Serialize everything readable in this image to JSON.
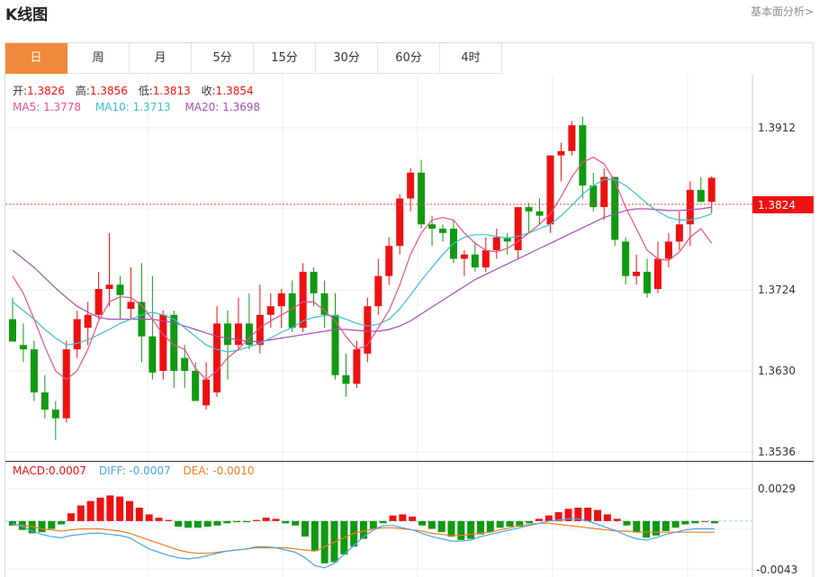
{
  "header": {
    "title": "K线图",
    "link": "基本面分析>"
  },
  "tabs": [
    {
      "label": "日",
      "active": true
    },
    {
      "label": "周"
    },
    {
      "label": "月"
    },
    {
      "label": "5分"
    },
    {
      "label": "15分"
    },
    {
      "label": "30分"
    },
    {
      "label": "60分"
    },
    {
      "label": "4时"
    }
  ],
  "legend": {
    "open_label": "开:",
    "open": "1.3826",
    "high_label": "高:",
    "high": "1.3856",
    "low_label": "低:",
    "low": "1.3813",
    "close_label": "收:",
    "close": "1.3854",
    "ma5_label": "MA5:",
    "ma5": "1.3778",
    "ma10_label": "MA10:",
    "ma10": "1.3713",
    "ma20_label": "MA20:",
    "ma20": "1.3698",
    "macd_label": "MACD:",
    "macd": "0.0007",
    "diff_label": "DIFF:",
    "diff": "-0.0007",
    "dea_label": "DEA:",
    "dea": "-0.0010"
  },
  "colors": {
    "up": "#ee1111",
    "down": "#119911",
    "ma5": "#e8508a",
    "ma10": "#3bbfd0",
    "ma20": "#a64eb5",
    "diff": "#48a5e6",
    "dea": "#f07c1e",
    "current": "#ff2a2a"
  },
  "chart_data": {
    "type": "candlestick",
    "price_axis": {
      "ticks": [
        "1.3912",
        "1.3724",
        "1.3630",
        "1.3536"
      ],
      "min": 1.3536,
      "max": 1.3912
    },
    "current_price": "1.3824",
    "macd_axis": {
      "ticks": [
        "0.0029",
        "-0.0043"
      ],
      "min": -0.0043,
      "max": 0.0029
    },
    "candles": [
      [
        1.369,
        1.3715,
        1.3665,
        1.3664
      ],
      [
        1.366,
        1.3685,
        1.364,
        1.3655
      ],
      [
        1.3655,
        1.3665,
        1.3595,
        1.3605
      ],
      [
        1.3605,
        1.3625,
        1.3575,
        1.3585
      ],
      [
        1.3585,
        1.3595,
        1.355,
        1.3575
      ],
      [
        1.3575,
        1.3665,
        1.357,
        1.3655
      ],
      [
        1.3655,
        1.37,
        1.3645,
        1.369
      ],
      [
        1.368,
        1.371,
        1.366,
        1.3695
      ],
      [
        1.3695,
        1.3745,
        1.369,
        1.3725
      ],
      [
        1.3725,
        1.379,
        1.3705,
        1.373
      ],
      [
        1.373,
        1.374,
        1.369,
        1.3718
      ],
      [
        1.3702,
        1.375,
        1.369,
        1.371
      ],
      [
        1.371,
        1.3755,
        1.364,
        1.367
      ],
      [
        1.367,
        1.374,
        1.362,
        1.3628
      ],
      [
        1.363,
        1.37,
        1.362,
        1.3695
      ],
      [
        1.3695,
        1.37,
        1.361,
        1.363
      ],
      [
        1.3645,
        1.366,
        1.361,
        1.363
      ],
      [
        1.363,
        1.364,
        1.3595,
        1.3595
      ],
      [
        1.359,
        1.364,
        1.3585,
        1.362
      ],
      [
        1.3605,
        1.3705,
        1.36,
        1.3685
      ],
      [
        1.3685,
        1.37,
        1.362,
        1.366
      ],
      [
        1.366,
        1.3715,
        1.3655,
        1.3685
      ],
      [
        1.3685,
        1.372,
        1.3655,
        1.366
      ],
      [
        1.366,
        1.373,
        1.365,
        1.3695
      ],
      [
        1.3695,
        1.372,
        1.368,
        1.3705
      ],
      [
        1.3705,
        1.3725,
        1.368,
        1.372
      ],
      [
        1.372,
        1.3735,
        1.3675,
        1.368
      ],
      [
        1.368,
        1.3755,
        1.3675,
        1.3745
      ],
      [
        1.3745,
        1.375,
        1.3705,
        1.372
      ],
      [
        1.372,
        1.3735,
        1.368,
        1.3695
      ],
      [
        1.3695,
        1.372,
        1.362,
        1.3625
      ],
      [
        1.3625,
        1.365,
        1.36,
        1.3615
      ],
      [
        1.3615,
        1.3665,
        1.361,
        1.3655
      ],
      [
        1.365,
        1.3715,
        1.364,
        1.3705
      ],
      [
        1.3705,
        1.376,
        1.3695,
        1.374
      ],
      [
        1.374,
        1.3785,
        1.373,
        1.3775
      ],
      [
        1.3775,
        1.3835,
        1.3765,
        1.383
      ],
      [
        1.383,
        1.3865,
        1.3815,
        1.386
      ],
      [
        1.386,
        1.3875,
        1.3795,
        1.38
      ],
      [
        1.38,
        1.381,
        1.3775,
        1.3795
      ],
      [
        1.3795,
        1.38,
        1.378,
        1.379
      ],
      [
        1.3795,
        1.3805,
        1.3755,
        1.376
      ],
      [
        1.376,
        1.377,
        1.374,
        1.3765
      ],
      [
        1.3765,
        1.378,
        1.3745,
        1.375
      ],
      [
        1.375,
        1.3785,
        1.3745,
        1.377
      ],
      [
        1.377,
        1.3795,
        1.376,
        1.3785
      ],
      [
        1.3785,
        1.379,
        1.3765,
        1.378
      ],
      [
        1.377,
        1.3805,
        1.376,
        1.382
      ],
      [
        1.382,
        1.3825,
        1.379,
        1.3815
      ],
      [
        1.3815,
        1.383,
        1.38,
        1.381
      ],
      [
        1.38,
        1.385,
        1.379,
        1.388
      ],
      [
        1.388,
        1.3895,
        1.385,
        1.3885
      ],
      [
        1.3885,
        1.392,
        1.388,
        1.3915
      ],
      [
        1.3915,
        1.3925,
        1.383,
        1.3845
      ],
      [
        1.3845,
        1.386,
        1.3815,
        1.382
      ],
      [
        1.382,
        1.3865,
        1.3805,
        1.3855
      ],
      [
        1.3855,
        1.3845,
        1.3775,
        1.3782
      ],
      [
        1.378,
        1.3785,
        1.373,
        1.374
      ],
      [
        1.374,
        1.3765,
        1.373,
        1.3745
      ],
      [
        1.3745,
        1.376,
        1.3715,
        1.372
      ],
      [
        1.3725,
        1.378,
        1.372,
        1.376
      ],
      [
        1.376,
        1.379,
        1.375,
        1.378
      ],
      [
        1.378,
        1.3815,
        1.377,
        1.38
      ],
      [
        1.38,
        1.385,
        1.3775,
        1.384
      ],
      [
        1.384,
        1.3855,
        1.383,
        1.3826
      ],
      [
        1.3826,
        1.3856,
        1.3813,
        1.3854
      ]
    ],
    "ma5": [
      1.374,
      1.372,
      1.369,
      1.3658,
      1.363,
      1.362,
      1.363,
      1.3655,
      1.3688,
      1.371,
      1.3716,
      1.3715,
      1.3706,
      1.369,
      1.3672,
      1.366,
      1.3655,
      1.3633,
      1.362,
      1.363,
      1.3645,
      1.3655,
      1.3668,
      1.368,
      1.3688,
      1.3695,
      1.3702,
      1.371,
      1.371,
      1.37,
      1.3688,
      1.367,
      1.3655,
      1.366,
      1.368,
      1.37,
      1.373,
      1.3765,
      1.379,
      1.3805,
      1.3808,
      1.3805,
      1.379,
      1.3778,
      1.377,
      1.3768,
      1.3772,
      1.378,
      1.379,
      1.38,
      1.3812,
      1.3832,
      1.3855,
      1.3872,
      1.3878,
      1.387,
      1.385,
      1.382,
      1.3795,
      1.377,
      1.376,
      1.3758,
      1.3768,
      1.3785,
      1.3795,
      1.3778
    ],
    "ma10": [
      1.371,
      1.37,
      1.369,
      1.3678,
      1.3668,
      1.366,
      1.3662,
      1.3666,
      1.3672,
      1.3678,
      1.3685,
      1.369,
      1.3695,
      1.3698,
      1.3695,
      1.369,
      1.368,
      1.367,
      1.366,
      1.3655,
      1.3652,
      1.3654,
      1.3658,
      1.3662,
      1.3668,
      1.3675,
      1.368,
      1.3688,
      1.3692,
      1.3694,
      1.3694,
      1.369,
      1.3685,
      1.3682,
      1.3684,
      1.369,
      1.3702,
      1.3718,
      1.3735,
      1.375,
      1.3765,
      1.3778,
      1.3785,
      1.3788,
      1.3788,
      1.3786,
      1.3784,
      1.3786,
      1.379,
      1.3795,
      1.38,
      1.381,
      1.3822,
      1.3835,
      1.3845,
      1.3852,
      1.3852,
      1.3845,
      1.3835,
      1.3824,
      1.3815,
      1.3808,
      1.3805,
      1.3805,
      1.3808,
      1.3812
    ],
    "ma20": [
      1.377,
      1.376,
      1.375,
      1.3738,
      1.3726,
      1.3715,
      1.3705,
      1.3698,
      1.3692,
      1.369,
      1.369,
      1.369,
      1.369,
      1.369,
      1.3688,
      1.3686,
      1.3682,
      1.3678,
      1.3674,
      1.367,
      1.3668,
      1.3666,
      1.3664,
      1.3664,
      1.3666,
      1.3668,
      1.367,
      1.3672,
      1.3674,
      1.3676,
      1.3678,
      1.3678,
      1.3677,
      1.3676,
      1.3676,
      1.3678,
      1.3682,
      1.3688,
      1.3696,
      1.3704,
      1.3712,
      1.372,
      1.3728,
      1.3736,
      1.3742,
      1.3748,
      1.3754,
      1.376,
      1.3766,
      1.3772,
      1.3778,
      1.3784,
      1.379,
      1.3796,
      1.3802,
      1.3808,
      1.3812,
      1.3816,
      1.3818,
      1.3818,
      1.3817,
      1.3816,
      1.3816,
      1.3817,
      1.3818,
      1.382
    ],
    "macd_hist": [
      -0.0004,
      -0.0008,
      -0.0011,
      -0.001,
      -0.0007,
      -0.0003,
      0.0007,
      0.0014,
      0.0018,
      0.0021,
      0.0023,
      0.0022,
      0.0018,
      0.0012,
      0.0006,
      0.0003,
      0.0001,
      -0.0005,
      -0.0006,
      -0.0006,
      -0.0005,
      -0.0004,
      -0.0002,
      -0.0001,
      -0.0001,
      0.0001,
      0.0003,
      0.0002,
      -0.0002,
      -0.0004,
      -0.0014,
      -0.0027,
      -0.0038,
      -0.0037,
      -0.003,
      -0.0023,
      -0.0016,
      -0.0007,
      -0.0002,
      0.0005,
      0.0006,
      0.0004,
      -0.0004,
      -0.0007,
      -0.001,
      -0.0014,
      -0.0017,
      -0.0016,
      -0.0012,
      -0.001,
      -0.0006,
      -0.0005,
      -0.0005,
      -0.0002,
      0.0002,
      0.0005,
      0.0008,
      0.0011,
      0.0012,
      0.0012,
      0.001,
      0.0006,
      0.0002,
      -0.0004,
      -0.001,
      -0.0015,
      -0.0013,
      -0.0009,
      -0.0006,
      -0.0003,
      -0.0002,
      0.0,
      -0.0002
    ],
    "diff": [
      -0.0002,
      -0.0005,
      -0.0009,
      -0.0012,
      -0.0014,
      -0.0015,
      -0.0013,
      -0.0012,
      -0.0011,
      -0.0011,
      -0.0012,
      -0.0013,
      -0.0015,
      -0.002,
      -0.0025,
      -0.0028,
      -0.0031,
      -0.0033,
      -0.0034,
      -0.0033,
      -0.0031,
      -0.0029,
      -0.0027,
      -0.0026,
      -0.0025,
      -0.0023,
      -0.0023,
      -0.0024,
      -0.0026,
      -0.0028,
      -0.0033,
      -0.004,
      -0.0042,
      -0.0038,
      -0.003,
      -0.0022,
      -0.0014,
      -0.0008,
      -0.0004,
      -0.0004,
      -0.0006,
      -0.0008,
      -0.0011,
      -0.0014,
      -0.0016,
      -0.0018,
      -0.0018,
      -0.0017,
      -0.0014,
      -0.0012,
      -0.001,
      -0.0008,
      -0.0006,
      -0.0004,
      -0.0002,
      0.0,
      0.0001,
      0.0002,
      0.0002,
      0.0,
      -0.0003,
      -0.0006,
      -0.0009,
      -0.0013,
      -0.0016,
      -0.0017,
      -0.0015,
      -0.0012,
      -0.001,
      -0.0008,
      -0.0007,
      -0.0007,
      -0.0007
    ],
    "dea": [
      -0.0003,
      -0.0004,
      -0.0005,
      -0.0007,
      -0.0008,
      -0.0009,
      -0.0008,
      -0.0007,
      -0.0007,
      -0.0007,
      -0.0008,
      -0.0009,
      -0.0011,
      -0.0014,
      -0.0017,
      -0.002,
      -0.0023,
      -0.0026,
      -0.0028,
      -0.0029,
      -0.0029,
      -0.0028,
      -0.0027,
      -0.0026,
      -0.0025,
      -0.0024,
      -0.0024,
      -0.0024,
      -0.0024,
      -0.0025,
      -0.0026,
      -0.0027,
      -0.0023,
      -0.0019,
      -0.0015,
      -0.0011,
      -0.0009,
      -0.0007,
      -0.0006,
      -0.0006,
      -0.0007,
      -0.0008,
      -0.0009,
      -0.0011,
      -0.0012,
      -0.0013,
      -0.0013,
      -0.0012,
      -0.0011,
      -0.001,
      -0.0008,
      -0.0006,
      -0.0004,
      -0.0003,
      -0.0002,
      -0.0002,
      -0.0003,
      -0.0004,
      -0.0005,
      -0.0006,
      -0.0007,
      -0.0008,
      -0.0009,
      -0.0009,
      -0.001,
      -0.001,
      -0.001,
      -0.001,
      -0.001,
      -0.001,
      -0.001,
      -0.001,
      -0.001
    ]
  }
}
